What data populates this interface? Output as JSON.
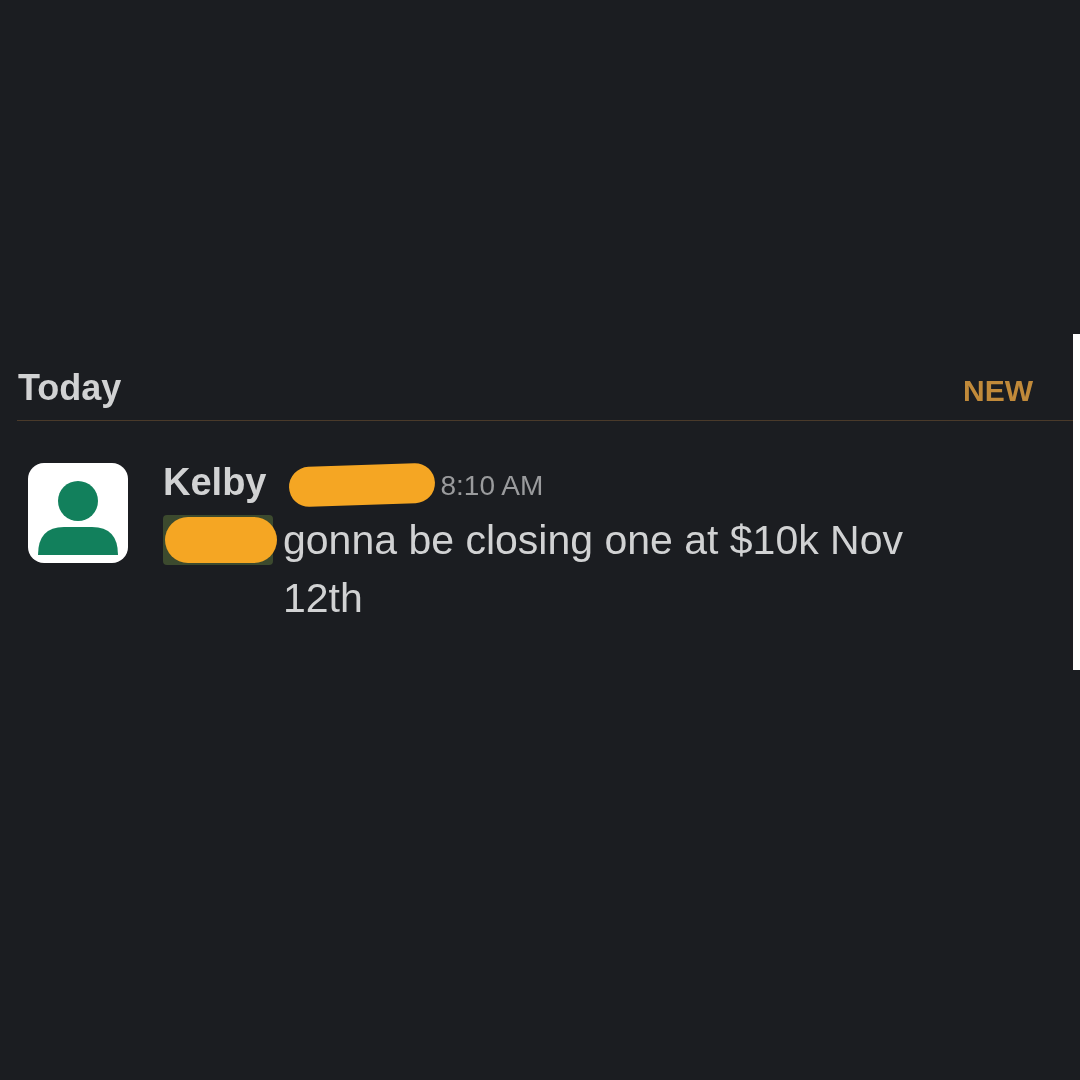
{
  "section": {
    "title": "Today",
    "new_label": "NEW"
  },
  "messages": [
    {
      "author": "Kelby",
      "time": "8:10 AM",
      "text": "gonna be closing one at $10k Nov 12th"
    }
  ]
}
